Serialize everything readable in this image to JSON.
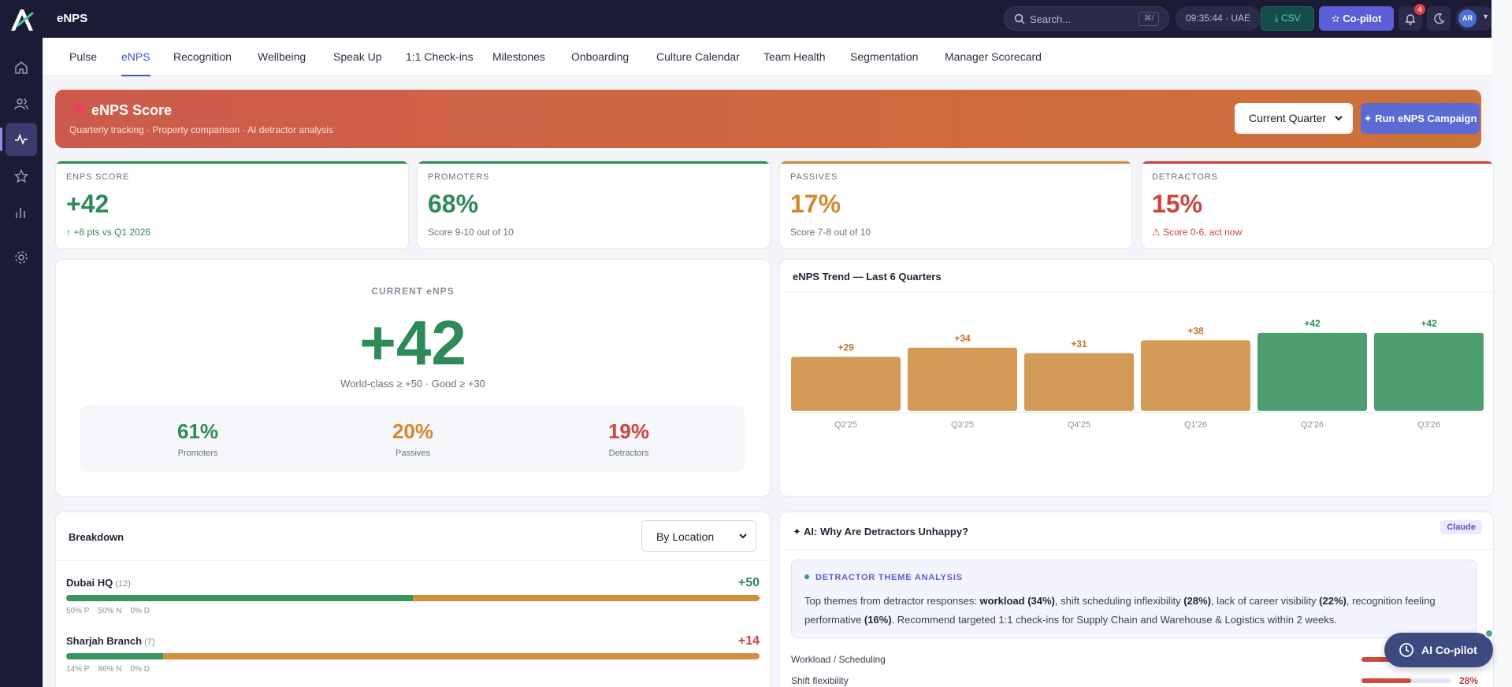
{
  "app": {
    "title": "eNPS"
  },
  "topbar": {
    "search_placeholder": "Search...",
    "shortcut": "⌘/",
    "clock": "09:35:44 · UAE",
    "csv_label": "⤓ CSV",
    "copilot_label": "✫ Co-pilot",
    "notification_count": "4",
    "avatar_initials": "AR"
  },
  "tabs": [
    {
      "label": "Pulse"
    },
    {
      "label": "eNPS"
    },
    {
      "label": "Recognition"
    },
    {
      "label": "Wellbeing"
    },
    {
      "label": "Speak Up"
    },
    {
      "label": "1:1 Check-ins"
    },
    {
      "label": "Milestones"
    },
    {
      "label": "Onboarding"
    },
    {
      "label": "Culture Calendar"
    },
    {
      "label": "Team Health"
    },
    {
      "label": "Segmentation"
    },
    {
      "label": "Manager Scorecard"
    }
  ],
  "banner": {
    "title": "eNPS Score",
    "subtitle": "Quarterly tracking · Property comparison · AI detractor analysis",
    "period_select": "Current Quarter",
    "run_label": "✦ Run eNPS Campaign"
  },
  "kpis": [
    {
      "label": "ENPS SCORE",
      "value": "+42",
      "sub": "↑ +8 pts vs Q1 2026",
      "color": "#2e8b57"
    },
    {
      "label": "PROMOTERS",
      "value": "68%",
      "sub": "Score 9-10 out of 10",
      "color": "#2e8b57"
    },
    {
      "label": "PASSIVES",
      "value": "17%",
      "sub": "Score 7-8 out of 10",
      "color": "#d2892f"
    },
    {
      "label": "DETRACTORS",
      "value": "15%",
      "sub": "⚠ Score 0-6, act now",
      "color": "#c8443c"
    }
  ],
  "current": {
    "label": "CURRENT eNPS",
    "value": "+42",
    "scale": "World-class ≥ +50 · Good ≥ +30",
    "split": [
      {
        "value": "61%",
        "label": "Promoters",
        "color": "#2e8b57"
      },
      {
        "value": "20%",
        "label": "Passives",
        "color": "#d2892f"
      },
      {
        "value": "19%",
        "label": "Detractors",
        "color": "#c8443c"
      }
    ]
  },
  "chart_data": {
    "type": "bar",
    "title": "eNPS Trend — Last 6 Quarters",
    "categories": [
      "Q2'25",
      "Q3'25",
      "Q4'25",
      "Q1'26",
      "Q2'26",
      "Q3'26"
    ],
    "values": [
      29,
      34,
      31,
      38,
      42,
      42
    ],
    "labels": [
      "+29",
      "+34",
      "+31",
      "+38",
      "+42",
      "+42"
    ],
    "colors": [
      "#d39b57",
      "#d39b57",
      "#d39b57",
      "#d39b57",
      "#4f9e72",
      "#4f9e72"
    ],
    "label_colors": [
      "#c0742a",
      "#c0742a",
      "#c0742a",
      "#c0742a",
      "#2e8b57",
      "#2e8b57"
    ],
    "ylim": [
      0,
      50
    ],
    "grid": false,
    "legend": "none"
  },
  "breakdown": {
    "title": "Breakdown",
    "group_select": "By Location",
    "rows": [
      {
        "name": "Dubai HQ",
        "count": "(12)",
        "score": "+50",
        "score_color": "#2e8b57",
        "promoters": 0.5,
        "meta": "50% P    50% N    0% D"
      },
      {
        "name": "Sharjah Branch",
        "count": "(7)",
        "score": "+14",
        "score_color": "#c8443c",
        "promoters": 0.14,
        "meta": "14% P    86% N    0% D"
      }
    ]
  },
  "ai": {
    "title": "✦ AI: Why Are Detractors Unhappy?",
    "badge": "Claude",
    "section": "DETRACTOR THEME ANALYSIS",
    "text_parts": [
      {
        "t": "Top themes from detractor responses: ",
        "b": false
      },
      {
        "t": "workload (34%)",
        "b": true
      },
      {
        "t": ", shift scheduling inflexibility ",
        "b": false
      },
      {
        "t": "(28%)",
        "b": true
      },
      {
        "t": ", lack of career visibility ",
        "b": false
      },
      {
        "t": "(22%)",
        "b": true
      },
      {
        "t": ", recognition feeling performative ",
        "b": false
      },
      {
        "t": "(16%)",
        "b": true
      },
      {
        "t": ". Recommend targeted 1:1 check-ins for Supply Chain and Warehouse & Logistics within 2 weeks.",
        "b": false
      }
    ],
    "topics": [
      {
        "label": "Workload / Scheduling",
        "value": 34,
        "pct": ""
      },
      {
        "label": "Shift flexibility",
        "value": 28,
        "pct": "28%"
      }
    ]
  },
  "fab": {
    "label": "AI Co-pilot"
  }
}
